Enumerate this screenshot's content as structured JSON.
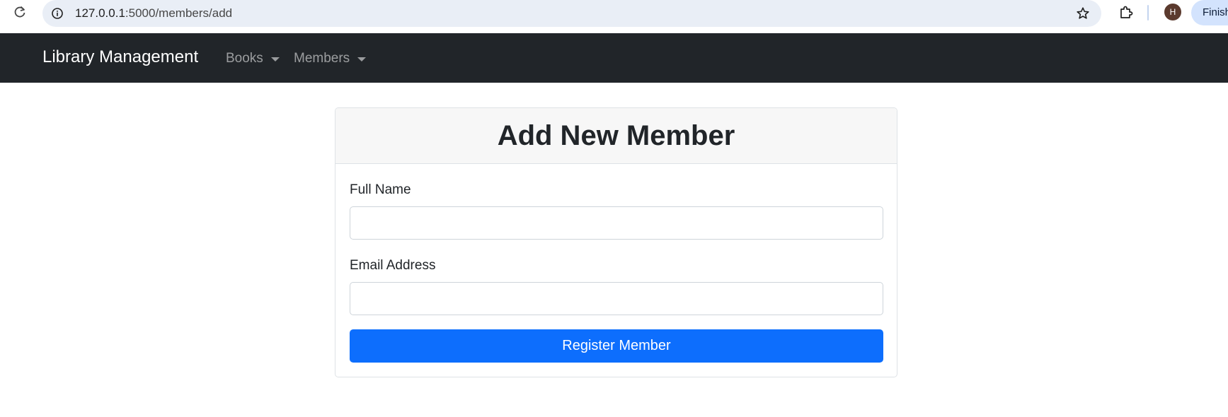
{
  "browser": {
    "url_host": "127.0.0.1",
    "url_path": ":5000/members/add",
    "avatar_initial": "H",
    "profile_chip": "Finish"
  },
  "navbar": {
    "brand": "Library Management",
    "items": [
      {
        "label": "Books"
      },
      {
        "label": "Members"
      }
    ]
  },
  "form": {
    "title": "Add New Member",
    "fields": [
      {
        "label": "Full Name",
        "value": "",
        "placeholder": ""
      },
      {
        "label": "Email Address",
        "value": "",
        "placeholder": ""
      }
    ],
    "submit_label": "Register Member"
  },
  "colors": {
    "navbar_bg": "#212529",
    "primary": "#0d6efd",
    "card_header_bg": "#f7f7f7",
    "omnibox_bg": "#e9eef6"
  },
  "icons": {
    "reload": "reload-icon",
    "site_info": "info-icon",
    "bookmark": "star-icon",
    "extensions": "puzzle-icon"
  }
}
